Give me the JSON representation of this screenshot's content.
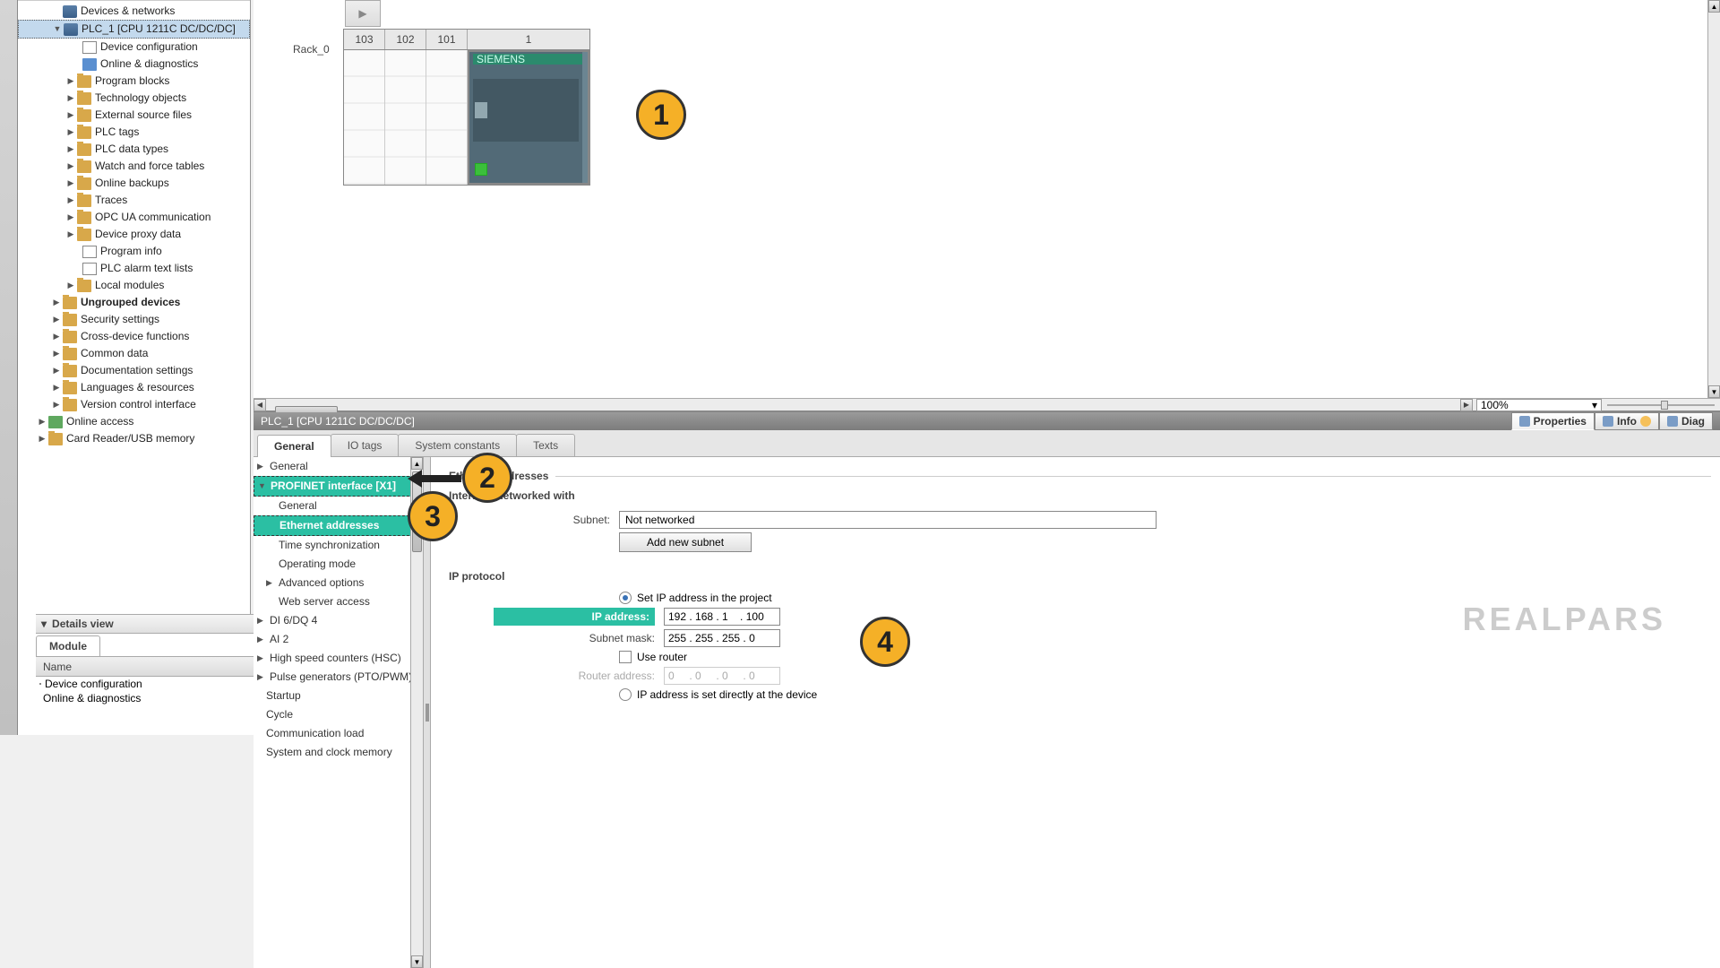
{
  "projectTree": {
    "devicesNetworks": "Devices & networks",
    "plc": "PLC_1 [CPU 1211C DC/DC/DC]",
    "deviceConfig": "Device configuration",
    "onlineDiag": "Online & diagnostics",
    "programBlocks": "Program blocks",
    "techObjects": "Technology objects",
    "extSource": "External source files",
    "plcTags": "PLC tags",
    "plcDataTypes": "PLC data types",
    "watchForce": "Watch and force tables",
    "onlineBackups": "Online backups",
    "traces": "Traces",
    "opcua": "OPC UA communication",
    "deviceProxy": "Device proxy data",
    "programInfo": "Program info",
    "plcAlarmText": "PLC alarm text lists",
    "localModules": "Local modules",
    "ungrouped": "Ungrouped devices",
    "security": "Security settings",
    "crossDevice": "Cross-device functions",
    "commonData": "Common data",
    "docSettings": "Documentation settings",
    "langRes": "Languages & resources",
    "versionControl": "Version control interface",
    "onlineAccess": "Online access",
    "cardReader": "Card Reader/USB memory"
  },
  "detailsView": {
    "title": "Details view",
    "tab": "Module",
    "colName": "Name",
    "row1": "Device configuration",
    "row2": "Online & diagnostics"
  },
  "rack": {
    "label": "Rack_0",
    "slots": [
      "103",
      "102",
      "101",
      "1"
    ],
    "plcTopLeft": "SIEMENS",
    "plcTopRight": ""
  },
  "zoom": "100%",
  "inspector": {
    "title": "PLC_1 [CPU 1211C DC/DC/DC]",
    "rightTabs": {
      "properties": "Properties",
      "info": "Info",
      "diag": "Diag"
    },
    "tabs": [
      "General",
      "IO tags",
      "System constants",
      "Texts"
    ],
    "propTree": {
      "general": "General",
      "profinet": "PROFINET interface [X1]",
      "pGeneral": "General",
      "ethernet": "Ethernet addresses",
      "timeSync": "Time synchronization",
      "opMode": "Operating mode",
      "advOpt": "Advanced options",
      "webServer": "Web server access",
      "di6dq4": "DI 6/DQ 4",
      "ai2": "AI 2",
      "hsc": "High speed counters (HSC)",
      "pto": "Pulse generators (PTO/PWM)",
      "startup": "Startup",
      "cycle": "Cycle",
      "commLoad": "Communication load",
      "sysClock": "System and clock memory"
    },
    "content": {
      "ethAddresses": "Ethernet addresses",
      "networkedWith": "Interface networked with",
      "subnetLabel": "Subnet:",
      "subnetValue": "Not networked",
      "addSubnet": "Add new subnet",
      "ipProtocol": "IP protocol",
      "setIpInProject": "Set IP address in the project",
      "ipAddressLabel": "IP address:",
      "ipAddressValue": "192 . 168 . 1    . 100",
      "subnetMaskLabel": "Subnet mask:",
      "subnetMaskValue": "255 . 255 . 255 . 0",
      "useRouter": "Use router",
      "routerAddressLabel": "Router address:",
      "routerAddressValue": "0     . 0     . 0     . 0",
      "ipDirect": "IP address is set directly at the device"
    }
  },
  "watermark": "REALPARS",
  "annotations": {
    "a1": "1",
    "a2": "2",
    "a3": "3",
    "a4": "4"
  }
}
